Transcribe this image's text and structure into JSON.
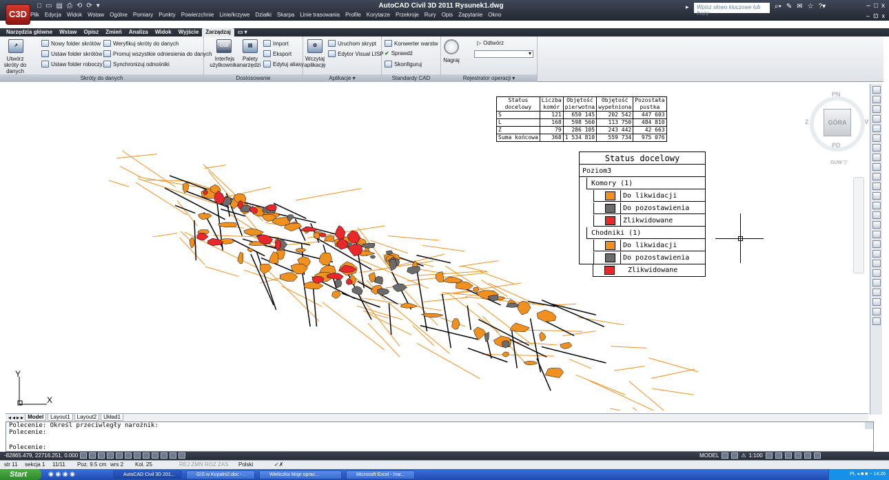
{
  "titlebar": {
    "app_icon": "C3D",
    "qat": [
      "□",
      "▭",
      "▤",
      "⎙",
      "⟲",
      "⟳",
      "▾"
    ],
    "title": "AutoCAD Civil 3D 2011    Rysunek1.dwg",
    "search_placeholder": "Wpisz słowo kluczowe lub frazę",
    "window_controls": [
      "–",
      "□",
      "x"
    ],
    "doc_controls": [
      "–",
      "⊡",
      "x"
    ]
  },
  "menubar": [
    "Plik",
    "Edycja",
    "Widok",
    "Wstaw",
    "Ogólne",
    "Pomiary",
    "Punkty",
    "Powierzchnie",
    "Linie/krzywe",
    "Działki",
    "Skarpa",
    "Linie trasowania",
    "Profile",
    "Korytarze",
    "Przekroje",
    "Rury",
    "Opis",
    "Zapytanie",
    "Okno"
  ],
  "tabs": [
    "Narzędzia główne",
    "Wstaw",
    "Opisz",
    "Zmień",
    "Analiza",
    "Widok",
    "Wyjście",
    "Zarządzaj",
    "▭ ▾"
  ],
  "active_tab": "Zarządzaj",
  "ribbon": {
    "p1": {
      "label": "Skróty do danych",
      "big": "Utwórz skróty do danych",
      "items": [
        "Nowy folder skrótów",
        "Ustaw folder skrótów",
        "Ustaw folder roboczy",
        "Weryfikuj skróty do danych",
        "Promuj wszystkie odniesienia do danych",
        "Synchronizuj odnośniki"
      ]
    },
    "p2": {
      "label": "Dostosowanie",
      "big1": "Interfejs użytkownika",
      "big1_icon": "CUI",
      "big2": "Palety narzędzi",
      "items": [
        "Import",
        "Eksport",
        "Edytuj aliasy"
      ]
    },
    "p3": {
      "label": "Aplikacje ▾",
      "big": "Wczytaj aplikację",
      "items": [
        "Uruchom skrypt",
        "Edytor Visual LISP"
      ]
    },
    "p4": {
      "label": "Standardy CAD",
      "items": [
        "Konwerter warstw",
        "Sprawdź",
        "Skonfiguruj"
      ]
    },
    "p5": {
      "label": "Rejestrator operacji ▾",
      "big": "Nagraj",
      "items": [
        "Odtwórz"
      ]
    }
  },
  "viewcube": {
    "n": "PN",
    "s": "PD",
    "w": "Z",
    "e": "W",
    "face": "GÓRA",
    "wcs": "GUW ▽"
  },
  "status_table": {
    "headers": [
      [
        "Status",
        "docelowy"
      ],
      [
        "Liczba",
        "komór"
      ],
      [
        "Objętość",
        "pierwotna"
      ],
      [
        "Objętość",
        "wypełniona"
      ],
      [
        "Pozostała",
        "pustka"
      ]
    ],
    "rows": [
      [
        "S",
        "121",
        "650 145",
        "202 542",
        "447 603"
      ],
      [
        "L",
        "168",
        "598 560",
        "113 750",
        "484 810"
      ],
      [
        "Z",
        "79",
        "286 105",
        "243 442",
        "42 663"
      ],
      [
        "Suma końcowa",
        "368",
        "1 534 810",
        "559 734",
        "975 076"
      ]
    ]
  },
  "legend": {
    "title": "Status docelowy",
    "level": "Poziom3",
    "group1": "Komory (1)",
    "group2": "Chodniki (1)",
    "items": [
      "Do likwidacji",
      "Do pozostawienia",
      "Zlikwidowane"
    ],
    "colors": [
      "#f0901e",
      "#6b6b6b",
      "#e8282a"
    ]
  },
  "ucs": {
    "x": "X",
    "y": "Y"
  },
  "layout_tabs": [
    "◂",
    "◂",
    "▸",
    "▸",
    "Model",
    "Layout1",
    "Layout2",
    "Układ1"
  ],
  "command": [
    "Polecenie: Określ przeciwległy narożnik:",
    "Polecenie:",
    "Polecenie:"
  ],
  "status": {
    "coords": "-82865.479, 22716.251, 0.000",
    "scale": "1:100",
    "model": "MODEL"
  },
  "word": {
    "page": "str 11",
    "section": "sekcja 1",
    "pages": "11/11",
    "pos": "Poz. 9.5 cm",
    "row": "wrs 2",
    "col": "Kol. 25",
    "flags": "REJ   ZMN   ROZ   ZAS",
    "lang": "Polski"
  },
  "taskbar": {
    "start": "Start",
    "tasks": [
      "AutoCAD Civil 3D 201...",
      "GIS w Kopalni2.doc - ...",
      "Wieliczka Moje oprac...",
      "Microsoft Excel - Inw..."
    ],
    "lang": "PL",
    "time": "14:26"
  },
  "colors": {
    "orange": "#f0901e",
    "gray": "#6b6b6b",
    "red": "#e8282a",
    "black": "#000000"
  }
}
